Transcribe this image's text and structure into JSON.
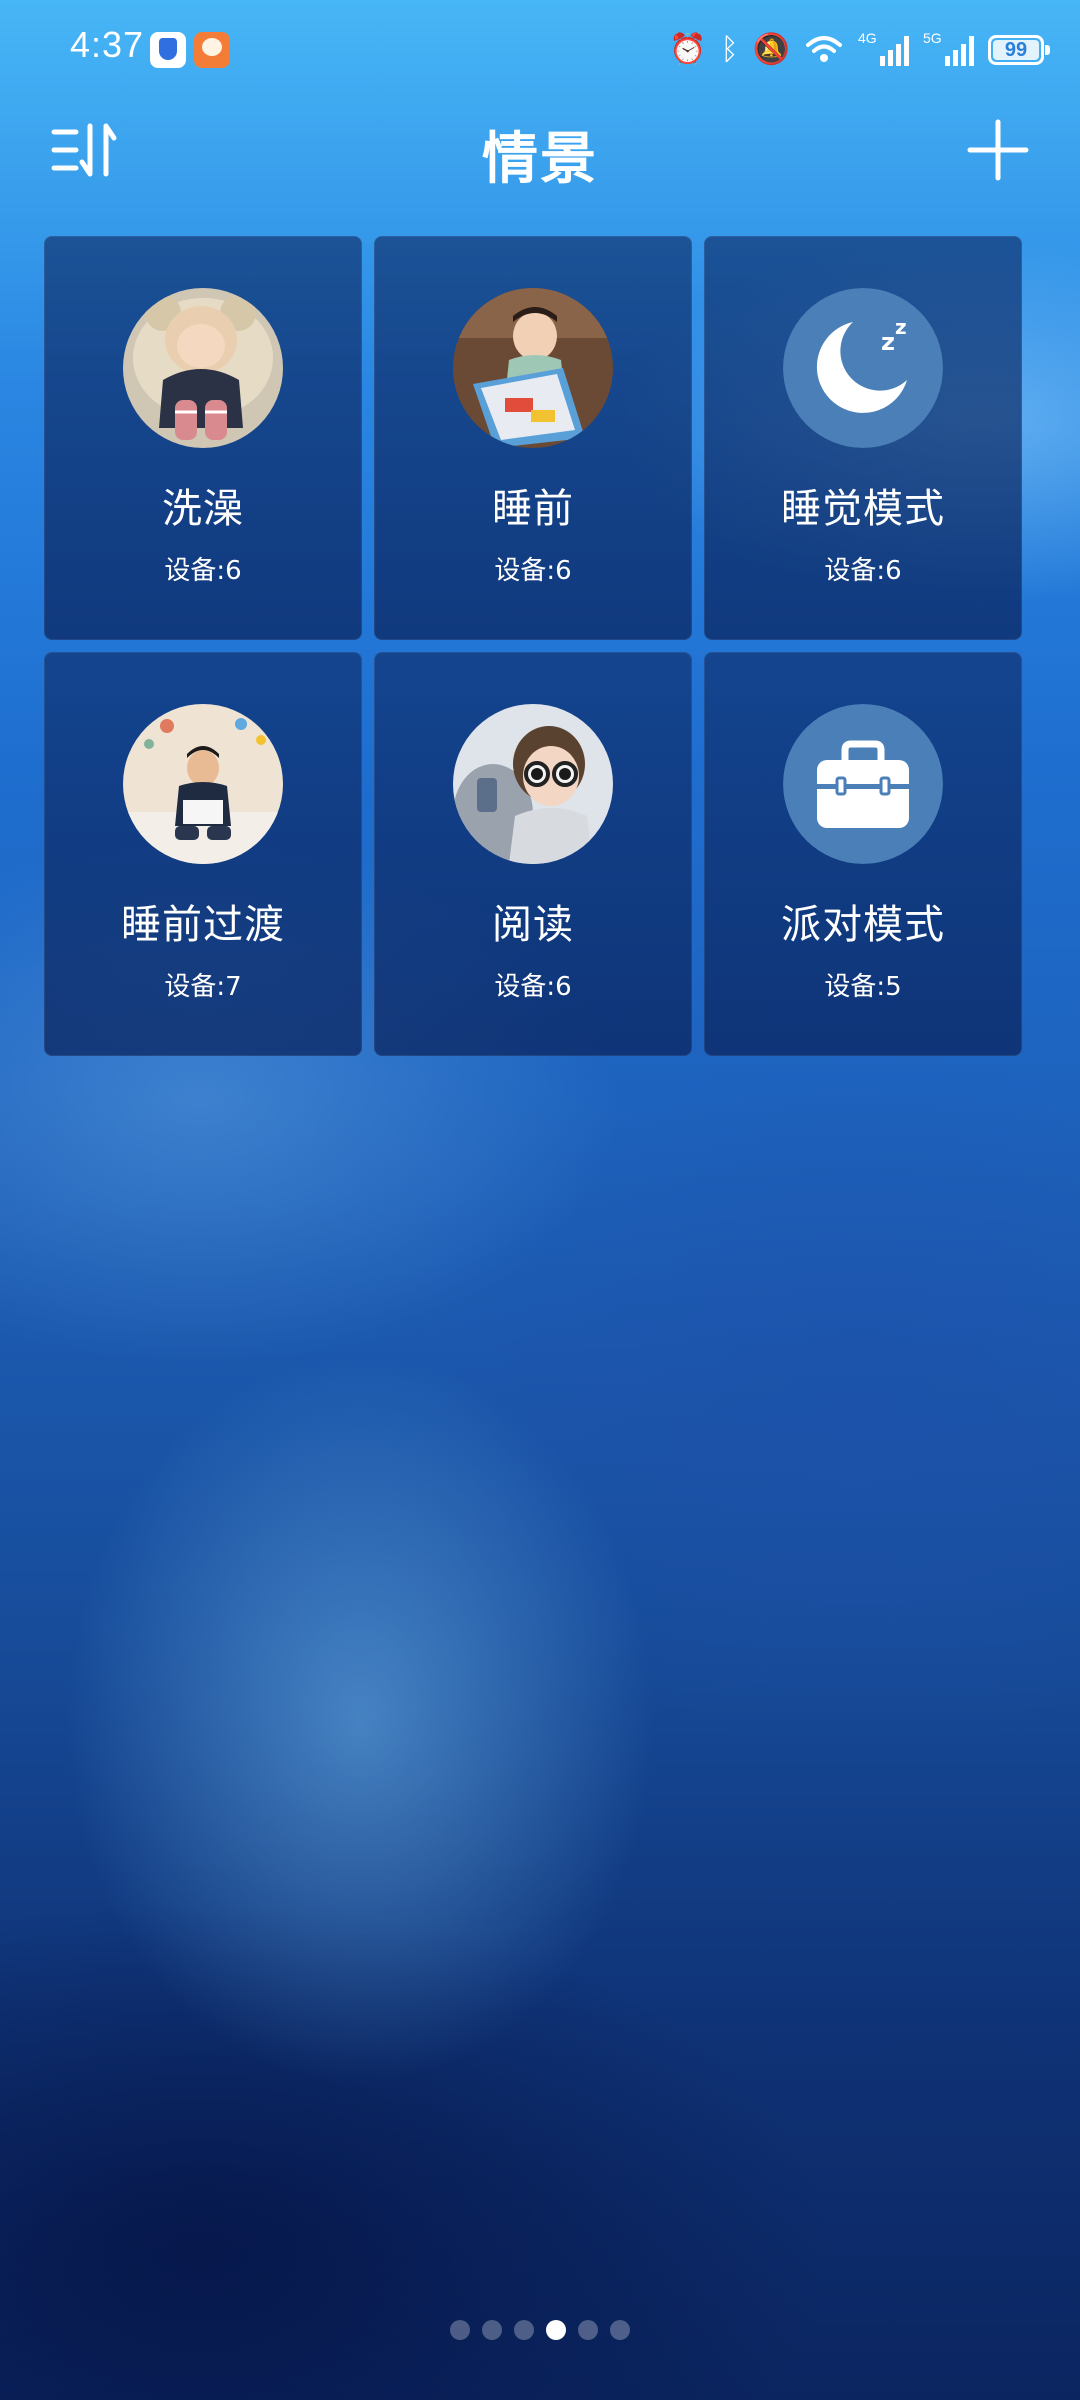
{
  "status_bar": {
    "time": "4:37",
    "network_1": "4G",
    "network_2": "5G",
    "battery": "99",
    "battery_level": 0.99
  },
  "header": {
    "title": "情景"
  },
  "scenes": [
    {
      "name": "洗澡",
      "devices": "设备:6",
      "icon": "photo-baby-bear-hat"
    },
    {
      "name": "睡前",
      "devices": "设备:6",
      "icon": "photo-child-with-book"
    },
    {
      "name": "睡觉模式",
      "devices": "设备:6",
      "icon": "moon-zzz-icon"
    },
    {
      "name": "睡前过渡",
      "devices": "设备:7",
      "icon": "photo-child-reading-on-bed"
    },
    {
      "name": "阅读",
      "devices": "设备:6",
      "icon": "photo-child-sunglasses"
    },
    {
      "name": "派对模式",
      "devices": "设备:5",
      "icon": "briefcase-icon"
    }
  ],
  "pagination": {
    "total": 6,
    "current": 4
  },
  "colors": {
    "card": "#0c2864",
    "icon_circle": "#4a7fb8",
    "accent": "#ffffff"
  }
}
